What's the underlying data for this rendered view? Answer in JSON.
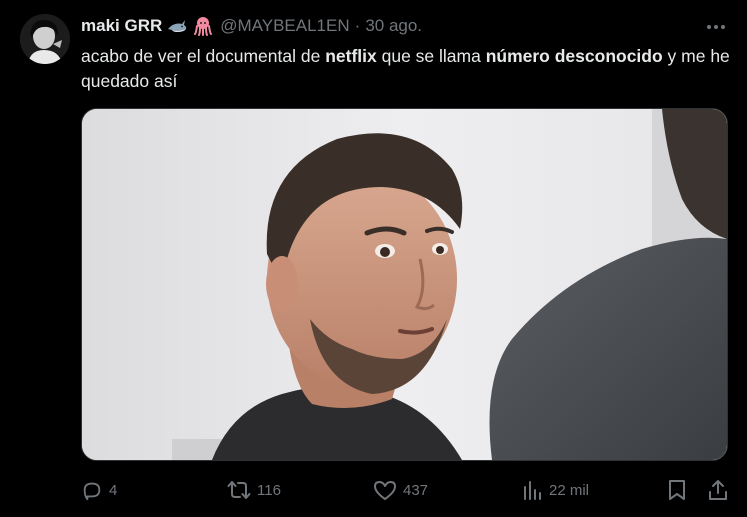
{
  "tweet": {
    "display_name": "maki GRR",
    "badges": [
      "shark-emoji",
      "octopus-emoji"
    ],
    "handle": "@MAYBEAL1EN",
    "separator": "·",
    "date": "30 ago.",
    "text_parts": [
      {
        "t": "acabo de ver el documental de "
      },
      {
        "t": "netflix",
        "bold": true
      },
      {
        "t": " que se llama "
      },
      {
        "t": "número desconocido",
        "bold": true
      },
      {
        "t": " y me he quedado así"
      }
    ],
    "media": {
      "kind": "photo",
      "description_icon": "meme-image"
    },
    "actions": {
      "reply_count": "4",
      "retweet_count": "116",
      "like_count": "437",
      "views_count": "22 mil"
    }
  },
  "colors": {
    "background": "#000000",
    "text": "#e7e9ea",
    "muted": "#71767b",
    "border": "#2f3336"
  }
}
